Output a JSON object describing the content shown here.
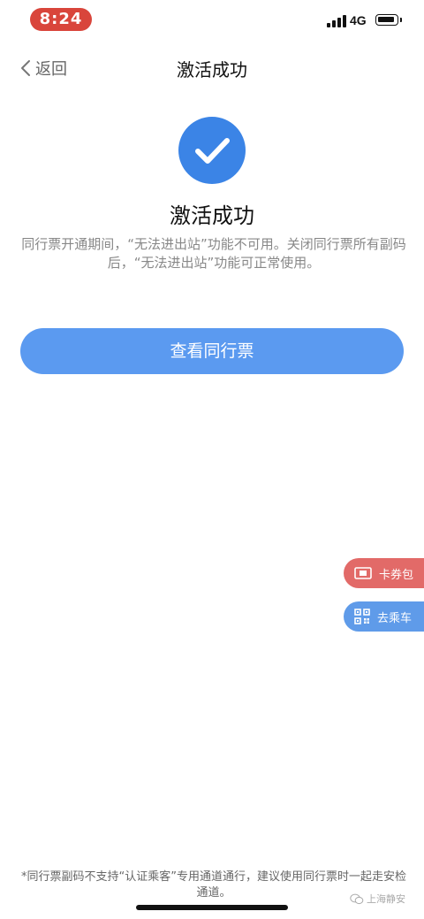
{
  "status_bar": {
    "time": "8:24",
    "network": "4G"
  },
  "nav": {
    "back_label": "返回",
    "title": "激活成功"
  },
  "result": {
    "title": "激活成功",
    "description": "同行票开通期间，“无法进出站”功能不可用。关闭同行票所有副码后，“无法进出站”功能可正常使用。"
  },
  "actions": {
    "view_ticket_label": "查看同行票"
  },
  "floating": {
    "coupon_label": "卡券包",
    "ride_label": "去乘车"
  },
  "footer": {
    "note": "*同行票副码不支持“认证乘客”专用通道通行，建议使用同行票时一起走安检通道。"
  },
  "watermark": {
    "text": "上海静安"
  },
  "colors": {
    "accent": "#3b84e6",
    "primary_button": "#5b9af0",
    "coupon": "#e26a68",
    "ride": "#5f9be9",
    "time_pill": "#d9453b"
  },
  "icons": {
    "back": "chevron-left-icon",
    "success": "check-circle-icon",
    "coupon": "ticket-icon",
    "ride": "qr-code-icon",
    "signal": "signal-icon",
    "battery": "battery-icon"
  }
}
